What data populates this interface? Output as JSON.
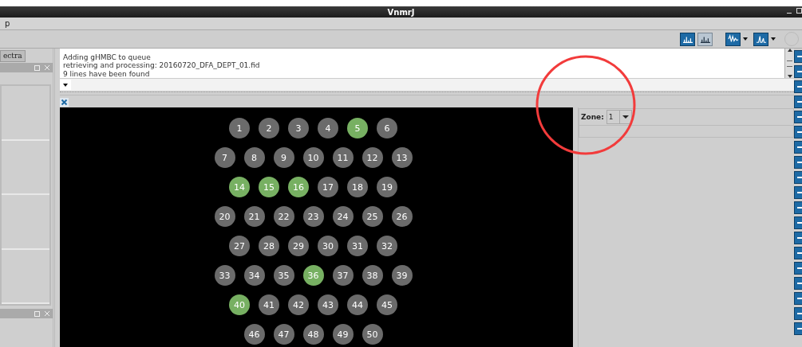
{
  "window": {
    "title": "VnmrJ"
  },
  "menu_bar": {
    "items": [
      {
        "label": "p"
      }
    ]
  },
  "left_panel": {
    "tab": {
      "label": "ectra"
    }
  },
  "console": {
    "lines": [
      "Adding gHMBC to queue",
      "retrieving and processing: 20160720_DFA_DEPT_01.fid",
      "9 lines have been found"
    ]
  },
  "tray_rows": [
    {
      "samples": [
        {
          "number": "1",
          "color": "#6b6b6b"
        },
        {
          "number": "2",
          "color": "#6b6b6b"
        },
        {
          "number": "3",
          "color": "#6b6b6b"
        },
        {
          "number": "4",
          "color": "#6b6b6b"
        },
        {
          "number": "5",
          "color": "#77b062"
        },
        {
          "number": "6",
          "color": "#6b6b6b"
        }
      ]
    },
    {
      "samples": [
        {
          "number": "7",
          "color": "#6b6b6b"
        },
        {
          "number": "8",
          "color": "#6b6b6b"
        },
        {
          "number": "9",
          "color": "#6b6b6b"
        },
        {
          "number": "10",
          "color": "#6b6b6b"
        },
        {
          "number": "11",
          "color": "#6b6b6b"
        },
        {
          "number": "12",
          "color": "#6b6b6b"
        },
        {
          "number": "13",
          "color": "#6b6b6b"
        }
      ]
    },
    {
      "samples": [
        {
          "number": "14",
          "color": "#77b062"
        },
        {
          "number": "15",
          "color": "#77b062"
        },
        {
          "number": "16",
          "color": "#77b062"
        },
        {
          "number": "17",
          "color": "#6b6b6b"
        },
        {
          "number": "18",
          "color": "#6b6b6b"
        },
        {
          "number": "19",
          "color": "#6b6b6b"
        }
      ]
    },
    {
      "samples": [
        {
          "number": "20",
          "color": "#6b6b6b"
        },
        {
          "number": "21",
          "color": "#6b6b6b"
        },
        {
          "number": "22",
          "color": "#6b6b6b"
        },
        {
          "number": "23",
          "color": "#6b6b6b"
        },
        {
          "number": "24",
          "color": "#6b6b6b"
        },
        {
          "number": "25",
          "color": "#6b6b6b"
        },
        {
          "number": "26",
          "color": "#6b6b6b"
        }
      ]
    },
    {
      "samples": [
        {
          "number": "27",
          "color": "#6b6b6b"
        },
        {
          "number": "28",
          "color": "#6b6b6b"
        },
        {
          "number": "29",
          "color": "#6b6b6b"
        },
        {
          "number": "30",
          "color": "#6b6b6b"
        },
        {
          "number": "31",
          "color": "#6b6b6b"
        },
        {
          "number": "32",
          "color": "#6b6b6b"
        }
      ]
    },
    {
      "samples": [
        {
          "number": "33",
          "color": "#6b6b6b"
        },
        {
          "number": "34",
          "color": "#6b6b6b"
        },
        {
          "number": "35",
          "color": "#6b6b6b"
        },
        {
          "number": "36",
          "color": "#77b062"
        },
        {
          "number": "37",
          "color": "#6b6b6b"
        },
        {
          "number": "38",
          "color": "#6b6b6b"
        },
        {
          "number": "39",
          "color": "#6b6b6b"
        }
      ]
    },
    {
      "samples": [
        {
          "number": "40",
          "color": "#77b062"
        },
        {
          "number": "41",
          "color": "#6b6b6b"
        },
        {
          "number": "42",
          "color": "#6b6b6b"
        },
        {
          "number": "43",
          "color": "#6b6b6b"
        },
        {
          "number": "44",
          "color": "#6b6b6b"
        },
        {
          "number": "45",
          "color": "#6b6b6b"
        }
      ]
    },
    {
      "samples": [
        {
          "number": "46",
          "color": "#6b6b6b"
        },
        {
          "number": "47",
          "color": "#6b6b6b"
        },
        {
          "number": "48",
          "color": "#6b6b6b"
        },
        {
          "number": "49",
          "color": "#6b6b6b"
        },
        {
          "number": "50",
          "color": "#6b6b6b"
        }
      ]
    }
  ],
  "zone": {
    "label": "Zone:",
    "value": "1"
  }
}
